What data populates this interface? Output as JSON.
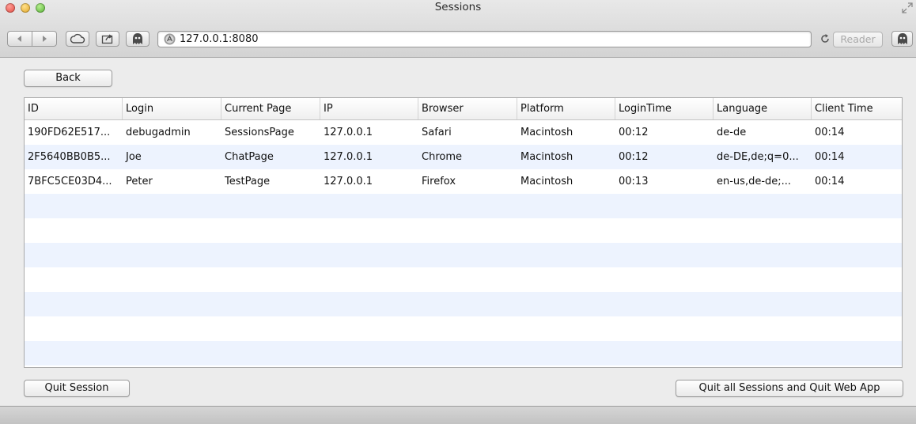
{
  "window": {
    "title": "Sessions"
  },
  "toolbar": {
    "address": "127.0.0.1:8080",
    "reader_label": "Reader"
  },
  "actions": {
    "back": "Back",
    "quit_session": "Quit Session",
    "quit_all": "Quit all Sessions and Quit Web App"
  },
  "table": {
    "headers": [
      "ID",
      "Login",
      "Current Page",
      "IP",
      "Browser",
      "Platform",
      "LoginTime",
      "Language",
      "Client Time"
    ],
    "rows": [
      [
        "190FD62E517...",
        "debugadmin",
        "SessionsPage",
        "127.0.0.1",
        "Safari",
        "Macintosh",
        "00:12",
        "de-de",
        "00:14"
      ],
      [
        "2F5640BB0B5...",
        "Joe",
        "ChatPage",
        "127.0.0.1",
        "Chrome",
        "Macintosh",
        "00:12",
        "de-DE,de;q=0...",
        "00:14"
      ],
      [
        "7BFC5CE03D4...",
        "Peter",
        "TestPage",
        "127.0.0.1",
        "Firefox",
        "Macintosh",
        "00:13",
        "en-us,de-de;...",
        "00:14"
      ]
    ],
    "empty_rows": 7
  },
  "colors": {
    "row_alt": "#edf3fe",
    "window_bg": "#ececec"
  },
  "icons": {
    "back": "triangle-left-icon",
    "forward": "triangle-right-icon",
    "icloud": "cloud-icon",
    "share": "share-icon",
    "extension": "ghostery-icon",
    "site": "site-favicon-icon",
    "reload": "reload-icon",
    "fullscreen": "fullscreen-icon"
  }
}
